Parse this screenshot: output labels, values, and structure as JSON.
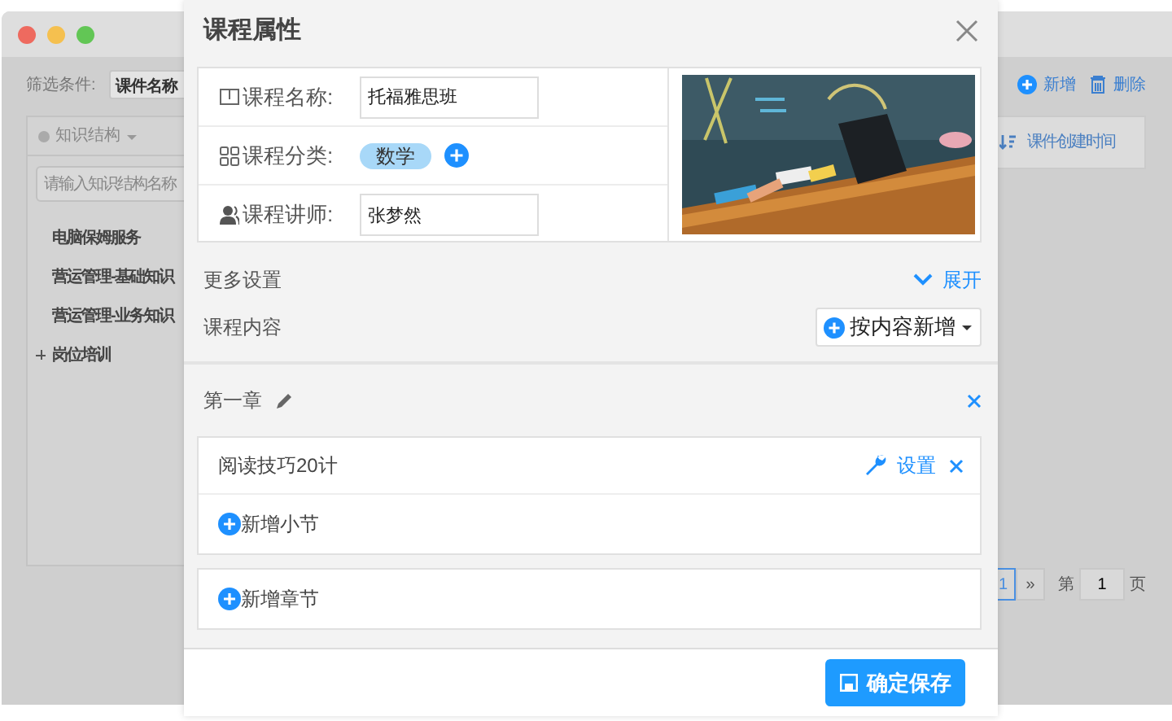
{
  "window": {
    "controls": [
      {
        "color": "#ee6a5f"
      },
      {
        "color": "#f5c04f"
      },
      {
        "color": "#62c655"
      }
    ]
  },
  "filter": {
    "label": "筛选条件:",
    "select": "课件名称"
  },
  "tree_panel": {
    "header": "知识结构",
    "search": {
      "placeholder": "请输入知识结构名称"
    },
    "items": [
      {
        "label": "电脑保姆服务",
        "has_children": false
      },
      {
        "label": "营运管理-基础知识",
        "has_children": false
      },
      {
        "label": "营运管理-业务知识",
        "has_children": false
      },
      {
        "label": "岗位培训",
        "has_children": true
      }
    ]
  },
  "toolbar": [
    {
      "label": "新增",
      "kind": "add"
    },
    {
      "label": "删除",
      "kind": "delete"
    }
  ],
  "table": {
    "columns": [
      "课件创建时间"
    ]
  },
  "pagination": {
    "pages": [
      {
        "label": "1",
        "selected": true
      }
    ],
    "next": "»",
    "page_prefix": "第",
    "page_value": "1",
    "page_suffix": "页"
  },
  "dialog": {
    "title": "课程属性",
    "fields": [
      {
        "kind": "input",
        "label": "课程名称:",
        "value": "托福雅思班"
      },
      {
        "kind": "tags",
        "label": "课程分类:",
        "tags": [
          "数学"
        ]
      },
      {
        "kind": "input",
        "label": "课程讲师:",
        "value": "张梦然"
      }
    ],
    "more_settings": {
      "label": "更多设置",
      "toggle": "展开",
      "expanded": false
    },
    "content": {
      "label": "课程内容",
      "add_menu": "按内容新增"
    },
    "chapters": [
      {
        "title": "第一章",
        "lessons": [
          {
            "title": "阅读技巧20计",
            "settings": "设置"
          }
        ],
        "add_lesson": "新增小节"
      }
    ],
    "add_chapter": "新增章节",
    "save": "确定保存"
  }
}
